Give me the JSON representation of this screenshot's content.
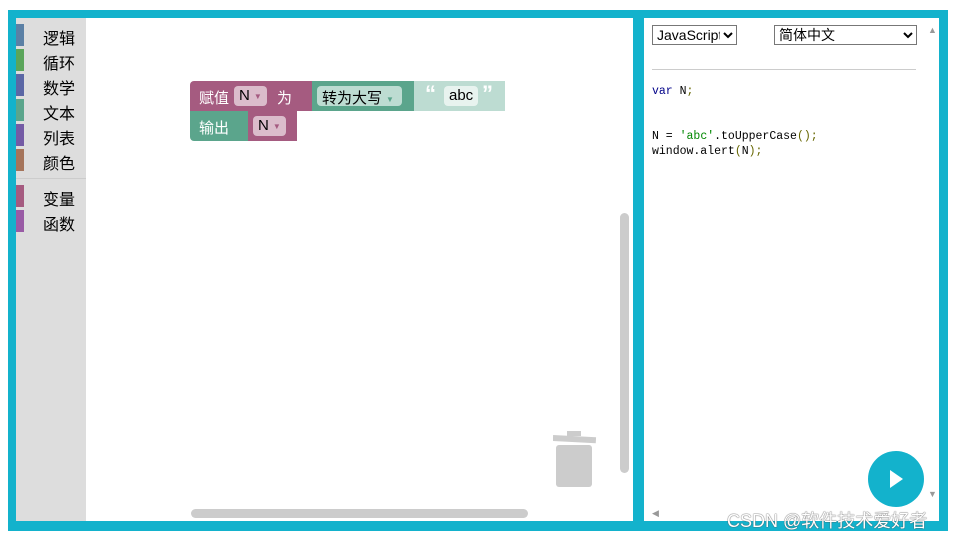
{
  "toolbox": {
    "categories": [
      {
        "label": "逻辑",
        "color": "#5b80a5"
      },
      {
        "label": "循环",
        "color": "#5ba55b"
      },
      {
        "label": "数学",
        "color": "#5b67a5"
      },
      {
        "label": "文本",
        "color": "#5ba58c"
      },
      {
        "label": "列表",
        "color": "#745ba5"
      },
      {
        "label": "颜色",
        "color": "#a5745b"
      },
      {
        "label": "变量",
        "color": "#a55b80"
      },
      {
        "label": "函数",
        "color": "#995ba5"
      }
    ]
  },
  "blocks": {
    "assign": {
      "label": "赋值",
      "var": "N",
      "to": "为"
    },
    "upper": {
      "option": "转为大写"
    },
    "text": {
      "open_quote": "“",
      "value": "abc",
      "close_quote": "”"
    },
    "print": {
      "label": "输出",
      "var": "N"
    }
  },
  "code_panel": {
    "language": "JavaScript",
    "ui_language": "简体中文",
    "code": {
      "line1_kw": "var",
      "line1_rest": " N",
      "semi": ";",
      "l2_a": "N = ",
      "l2_str": "'abc'",
      "l2_b": ".toUpperCase",
      "l2_p": "();",
      "l3_a": "window.alert",
      "l3_p1": "(",
      "l3_b": "N",
      "l3_p2": ");"
    }
  },
  "watermark": "CSDN @软件技术爱好者",
  "colors": {
    "accent": "#13b2cc",
    "variables": "#a55b80",
    "text": "#5ba58c"
  }
}
